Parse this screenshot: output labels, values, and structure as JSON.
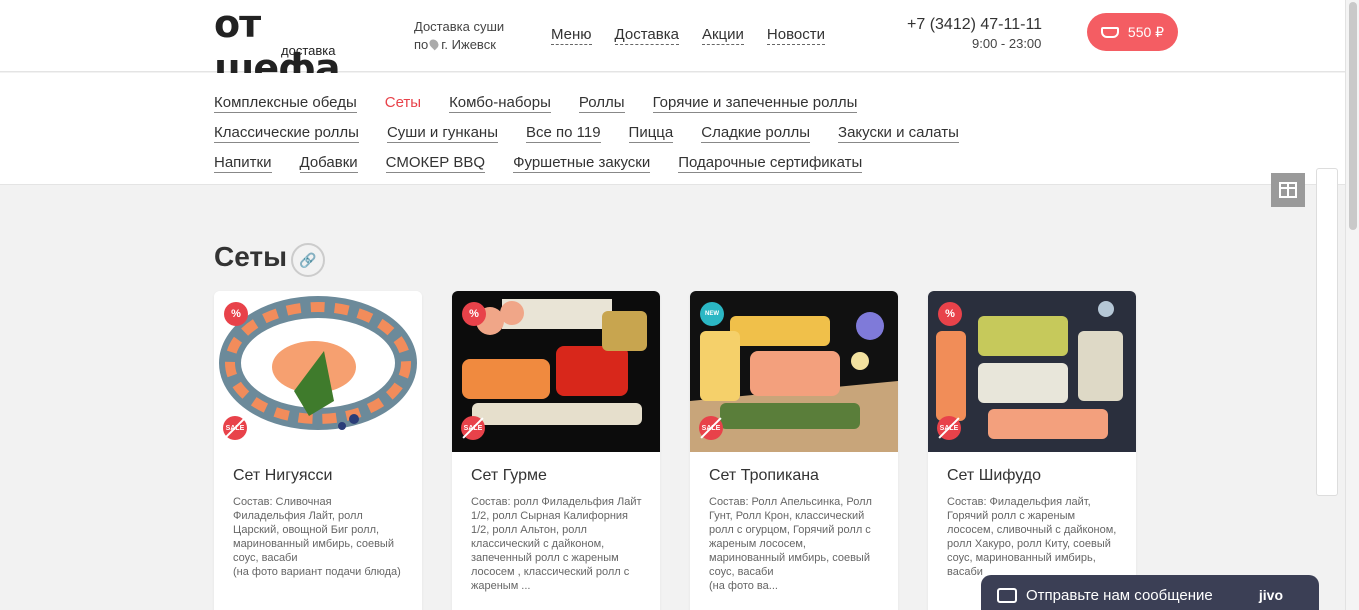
{
  "header": {
    "logo_main": "от шефа",
    "logo_sub": "доставка",
    "delivery_line1": "Доставка суши",
    "delivery_line2_prefix": "по",
    "delivery_city": "г. Ижевск",
    "nav": [
      "Меню",
      "Доставка",
      "Акции",
      "Новости"
    ],
    "phone": "+7 (3412) 47-11-11",
    "hours": "9:00 - 23:00",
    "cart_total": "550 ₽",
    "cart_icon": "basket-icon"
  },
  "categories": {
    "row1": [
      "Комплексные обеды",
      "Сеты",
      "Комбо-наборы",
      "Роллы",
      "Горячие и запеченные роллы"
    ],
    "row2": [
      "Классические роллы",
      "Суши и гунканы",
      "Все по 119",
      "Пицца",
      "Сладкие роллы",
      "Закуски и салаты"
    ],
    "row3": [
      "Напитки",
      "Добавки",
      "СМОКЕР BBQ",
      "Фуршетные закуски",
      "Подарочные сертификаты"
    ],
    "active": "Сеты"
  },
  "section": {
    "title": "Сеты",
    "link_icon": "link-icon"
  },
  "badges": {
    "percent": "%",
    "new": "NEW",
    "sale": "SALE"
  },
  "products": [
    {
      "name": "Сет Нигуясси",
      "description": "Состав: Сливочная Филадельфия Лайт, ролл Царский, овощной Биг ролл, маринованный имбирь, соевый соус, васаби",
      "note": "(на фото вариант подачи блюда)",
      "top_badge": "%",
      "bg": "#ffffff"
    },
    {
      "name": "Сет Гурме",
      "description": "Состав: ролл Филадельфия Лайт 1/2, ролл Сырная Калифорния 1/2, ролл Альтон, ролл классический с дайконом, запеченный ролл с жареным лососем , классический ролл с жареным ...",
      "note": "",
      "top_badge": "%",
      "bg": "#0c0c0c"
    },
    {
      "name": "Сет Тропикана",
      "description": "Состав: Ролл Апельсинка, Ролл Гунт, Ролл Крон, классический ролл с огурцом, Горячий ролл с жареным лососем, маринованный имбирь, соевый соус, васаби",
      "note": "(на фото ва...",
      "top_badge": "NEW",
      "bg": "#111111"
    },
    {
      "name": "Сет Шифудо",
      "description": "Состав: Филадельфия лайт, Горячий ролл с жареным лососем, сливочный с дайконом, ролл Хакуро, ролл Киту, соевый соус, маринованный имбирь, васаби",
      "note": "",
      "top_badge": "%",
      "bg": "#2a2f3d"
    }
  ],
  "chat": {
    "label": "Отправьте нам сообщение",
    "brand": "jivo"
  },
  "widgets": {
    "gift_icon": "gift-icon"
  }
}
